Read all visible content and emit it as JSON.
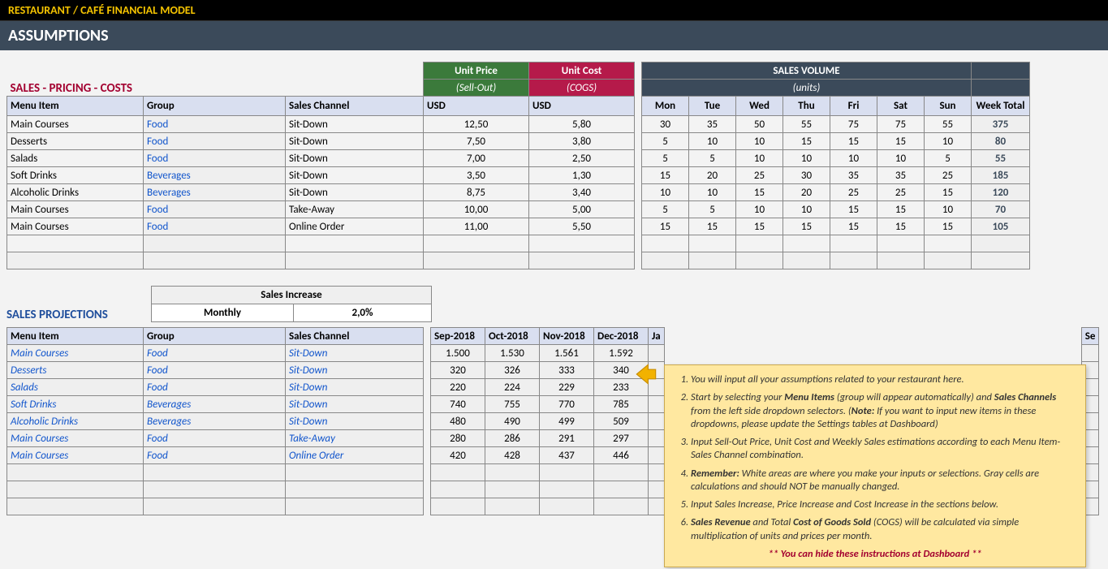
{
  "titlebar": "RESTAURANT / CAFÉ FINANCIAL MODEL",
  "subtitle": "ASSUMPTIONS",
  "section1": "SALES - PRICING - COSTS",
  "section2": "SALES PROJECTIONS",
  "headers": {
    "menu_item": "Menu Item",
    "group": "Group",
    "channel": "Sales Channel",
    "unit_price": "Unit Price",
    "unit_price_sub": "(Sell-Out)",
    "unit_cost": "Unit Cost",
    "unit_cost_sub": "(COGS)",
    "usd": "USD",
    "sales_volume": "SALES VOLUME",
    "sales_volume_sub": "(units)",
    "days": [
      "Mon",
      "Tue",
      "Wed",
      "Thu",
      "Fri",
      "Sat",
      "Sun"
    ],
    "week_total": "Week Total",
    "sales_increase": "Sales Increase",
    "monthly": "Monthly",
    "monthly_val": "2,0%"
  },
  "rows": [
    {
      "item": "Main Courses",
      "group": "Food",
      "channel": "Sit-Down",
      "price": "12,50",
      "cost": "5,80",
      "vol": [
        "30",
        "35",
        "50",
        "55",
        "75",
        "75",
        "55"
      ],
      "wk": "375"
    },
    {
      "item": "Desserts",
      "group": "Food",
      "channel": "Sit-Down",
      "price": "7,50",
      "cost": "3,80",
      "vol": [
        "5",
        "10",
        "10",
        "15",
        "15",
        "15",
        "10"
      ],
      "wk": "80"
    },
    {
      "item": "Salads",
      "group": "Food",
      "channel": "Sit-Down",
      "price": "7,00",
      "cost": "2,50",
      "vol": [
        "5",
        "5",
        "10",
        "10",
        "10",
        "10",
        "5"
      ],
      "wk": "55"
    },
    {
      "item": "Soft Drinks",
      "group": "Beverages",
      "channel": "Sit-Down",
      "price": "3,50",
      "cost": "1,30",
      "vol": [
        "15",
        "20",
        "25",
        "30",
        "35",
        "35",
        "25"
      ],
      "wk": "185"
    },
    {
      "item": "Alcoholic Drinks",
      "group": "Beverages",
      "channel": "Sit-Down",
      "price": "8,75",
      "cost": "3,40",
      "vol": [
        "10",
        "10",
        "15",
        "20",
        "25",
        "25",
        "15"
      ],
      "wk": "120"
    },
    {
      "item": "Main Courses",
      "group": "Food",
      "channel": "Take-Away",
      "price": "10,00",
      "cost": "5,00",
      "vol": [
        "5",
        "5",
        "10",
        "10",
        "15",
        "15",
        "10"
      ],
      "wk": "70"
    },
    {
      "item": "Main Courses",
      "group": "Food",
      "channel": "Online Order",
      "price": "11,00",
      "cost": "5,50",
      "vol": [
        "15",
        "15",
        "15",
        "15",
        "15",
        "15",
        "15"
      ],
      "wk": "105"
    }
  ],
  "proj_months": [
    "Sep-2018",
    "Oct-2018",
    "Nov-2018",
    "Dec-2018"
  ],
  "proj_partial": "Ja",
  "proj_partial2": "Se",
  "proj_rows": [
    {
      "item": "Main Courses",
      "group": "Food",
      "channel": "Sit-Down",
      "vals": [
        "1.500",
        "1.530",
        "1.561",
        "1.592"
      ]
    },
    {
      "item": "Desserts",
      "group": "Food",
      "channel": "Sit-Down",
      "vals": [
        "320",
        "326",
        "333",
        "340"
      ]
    },
    {
      "item": "Salads",
      "group": "Food",
      "channel": "Sit-Down",
      "vals": [
        "220",
        "224",
        "229",
        "233"
      ]
    },
    {
      "item": "Soft Drinks",
      "group": "Beverages",
      "channel": "Sit-Down",
      "vals": [
        "740",
        "755",
        "770",
        "785"
      ]
    },
    {
      "item": "Alcoholic Drinks",
      "group": "Beverages",
      "channel": "Sit-Down",
      "vals": [
        "480",
        "490",
        "499",
        "509"
      ]
    },
    {
      "item": "Main Courses",
      "group": "Food",
      "channel": "Take-Away",
      "vals": [
        "280",
        "286",
        "291",
        "297"
      ]
    },
    {
      "item": "Main Courses",
      "group": "Food",
      "channel": "Online Order",
      "vals": [
        "420",
        "428",
        "437",
        "446"
      ]
    }
  ],
  "callout": {
    "li1a": "You will input all your assumptions related to your restaurant here.",
    "li2a": "Start by selecting your ",
    "li2b": "Menu Items",
    "li2c": " (group will appear automatically) and ",
    "li2d": "Sales Channels",
    "li2e": " from the left side dropdown selectors. (",
    "li2f": "Note:",
    "li2g": " If you want to input new items in these dropdowns, please update the Settings tables at Dashboard)",
    "li3a": "Input Sell-Out Price, Unit Cost and Weekly Sales estimations according to each Menu Item-Sales Channel combination.",
    "li4a": "Remember:",
    "li4b": " White areas are where you make your inputs or selections. Gray cells are calculations and should NOT be manually changed.",
    "li5a": "Input Sales Increase, Price Increase and Cost Increase in the sections below.",
    "li6a": "Sales Revenue",
    "li6b": " and Total ",
    "li6c": "Cost of Goods Sold",
    "li6d": " (COGS) will be calculated via simple multiplication of units and prices per month.",
    "footer": "** You can hide these instructions at Dashboard **"
  }
}
